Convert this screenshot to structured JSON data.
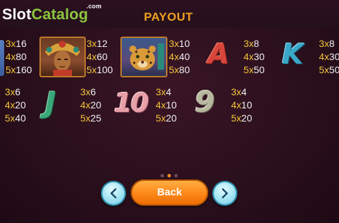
{
  "header": {
    "logo_part1": "Slot",
    "logo_part2": "Catalog",
    "logo_suffix": ".com",
    "title": "PAYOUT"
  },
  "symbols": {
    "chief": {
      "icon": "aztec-chief-icon",
      "payouts": [
        {
          "count": "3x",
          "value": "12"
        },
        {
          "count": "4x",
          "value": "60"
        },
        {
          "count": "5x",
          "value": "100"
        }
      ]
    },
    "jaguar": {
      "icon": "jaguar-icon",
      "payouts": [
        {
          "count": "3x",
          "value": "10"
        },
        {
          "count": "4x",
          "value": "40"
        },
        {
          "count": "5x",
          "value": "80"
        }
      ]
    },
    "a": {
      "glyph": "A",
      "payouts": [
        {
          "count": "3x",
          "value": "8"
        },
        {
          "count": "4x",
          "value": "30"
        },
        {
          "count": "5x",
          "value": "50"
        }
      ]
    },
    "k": {
      "glyph": "K",
      "payouts": [
        {
          "count": "3x",
          "value": "8"
        },
        {
          "count": "4x",
          "value": "30"
        },
        {
          "count": "5x",
          "value": "50"
        }
      ]
    },
    "partial_left": {
      "payouts": [
        {
          "count": "3x",
          "value": "16"
        },
        {
          "count": "4x",
          "value": "80"
        },
        {
          "count": "5x",
          "value": "160"
        }
      ]
    },
    "q": {
      "payouts": [
        {
          "count": "3x",
          "value": "6"
        },
        {
          "count": "4x",
          "value": "20"
        },
        {
          "count": "5x",
          "value": "40"
        }
      ]
    },
    "j": {
      "glyph": "J",
      "payouts": [
        {
          "count": "3x",
          "value": "6"
        },
        {
          "count": "4x",
          "value": "20"
        },
        {
          "count": "5x",
          "value": "25"
        }
      ]
    },
    "ten": {
      "glyph": "10",
      "payouts": [
        {
          "count": "3x",
          "value": "4"
        },
        {
          "count": "4x",
          "value": "10"
        },
        {
          "count": "5x",
          "value": "20"
        }
      ]
    },
    "nine": {
      "glyph": "9",
      "payouts": [
        {
          "count": "3x",
          "value": "4"
        },
        {
          "count": "4x",
          "value": "10"
        },
        {
          "count": "5x",
          "value": "20"
        }
      ]
    }
  },
  "pagination": {
    "pages": 3,
    "active": 1
  },
  "buttons": {
    "back_label": "Back",
    "prev_icon": "chevron-left-icon",
    "next_icon": "chevron-right-icon"
  },
  "colors": {
    "accent": "#f08a20",
    "title": "#f0a020",
    "multiplier": "#f3c53a",
    "nav": "#a8e6f4"
  }
}
